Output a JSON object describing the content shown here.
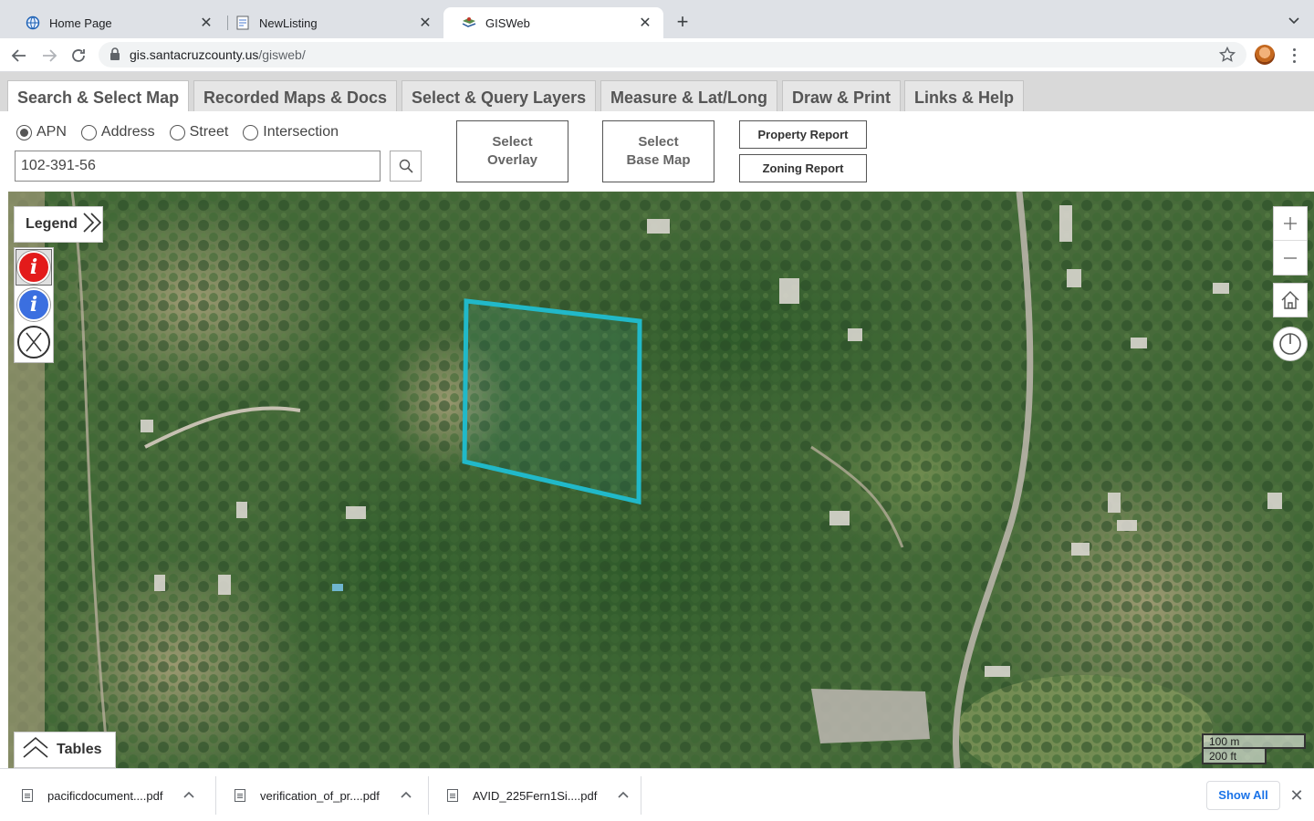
{
  "browser": {
    "tabs": [
      {
        "title": "Home Page",
        "active": false,
        "icon": "globe-map-icon"
      },
      {
        "title": "NewListing",
        "active": false,
        "icon": "document-icon"
      },
      {
        "title": "GISWeb",
        "active": true,
        "icon": "gis-map-icon"
      }
    ],
    "url_domain": "gis.santacruzcounty.us",
    "url_path": "/gisweb/"
  },
  "app": {
    "tabs": [
      "Search & Select Map",
      "Recorded Maps & Docs",
      "Select & Query Layers",
      "Measure & Lat/Long",
      "Draw & Print",
      "Links & Help"
    ],
    "search_modes": [
      {
        "label": "APN",
        "selected": true
      },
      {
        "label": "Address",
        "selected": false
      },
      {
        "label": "Street",
        "selected": false
      },
      {
        "label": "Intersection",
        "selected": false
      }
    ],
    "search_value": "102-391-56",
    "select_overlay": [
      "Select",
      "Overlay"
    ],
    "select_base_map": [
      "Select",
      "Base Map"
    ],
    "property_report": "Property Report",
    "zoning_report": "Zoning Report"
  },
  "map": {
    "legend_label": "Legend",
    "tables_label": "Tables",
    "scale_metric": "100 m",
    "scale_imperial": "200 ft",
    "parcel_color": "#21b9c9"
  },
  "downloads": {
    "files": [
      "pacificdocument....pdf",
      "verification_of_pr....pdf",
      "AVID_225Fern1Si....pdf"
    ],
    "show_all": "Show All"
  }
}
